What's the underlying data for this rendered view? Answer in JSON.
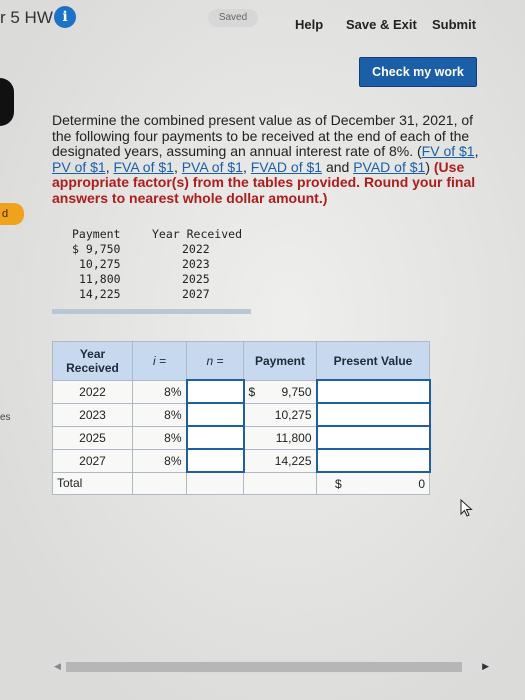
{
  "header": {
    "title": "r 5 HW",
    "info_icon": "i",
    "saved_badge": "Saved",
    "help": "Help",
    "save_exit": "Save & Exit",
    "submit": "Submit"
  },
  "check_button": "Check my work",
  "side_tab": "d",
  "side_text": "es",
  "question": {
    "intro": "Determine the combined present value as of December 31, 2021, of the following four payments to be received at the end of each of the designated years, assuming an annual interest rate of 8%.",
    "links": [
      "FV of $1",
      "PV of $1",
      "FVA of $1",
      "PVA of $1",
      "FVAD of $1",
      "PVAD of $1"
    ],
    "instruction": "(Use appropriate factor(s) from the tables provided. Round your final answers to nearest whole dollar amount.)"
  },
  "given_table": {
    "headers": [
      "Payment",
      "Year Received"
    ],
    "rows": [
      {
        "payment": "$ 9,750",
        "year": "2022"
      },
      {
        "payment": "10,275",
        "year": "2023"
      },
      {
        "payment": "11,800",
        "year": "2025"
      },
      {
        "payment": "14,225",
        "year": "2027"
      }
    ]
  },
  "answer_table": {
    "headers": [
      "Year Received",
      "i =",
      "n =",
      "Payment",
      "Present Value"
    ],
    "rows": [
      {
        "year": "2022",
        "rate": "8%",
        "payment_prefix": "$",
        "payment": "9,750"
      },
      {
        "year": "2023",
        "rate": "8%",
        "payment_prefix": "",
        "payment": "10,275"
      },
      {
        "year": "2025",
        "rate": "8%",
        "payment_prefix": "",
        "payment": "11,800"
      },
      {
        "year": "2027",
        "rate": "8%",
        "payment_prefix": "",
        "payment": "14,225"
      }
    ],
    "total_label": "Total",
    "total_prefix": "$",
    "total_value": "0"
  },
  "colors": {
    "accent": "#1b5fa8",
    "table_header": "#c6d9ee",
    "instruction": "#b01c1c"
  }
}
